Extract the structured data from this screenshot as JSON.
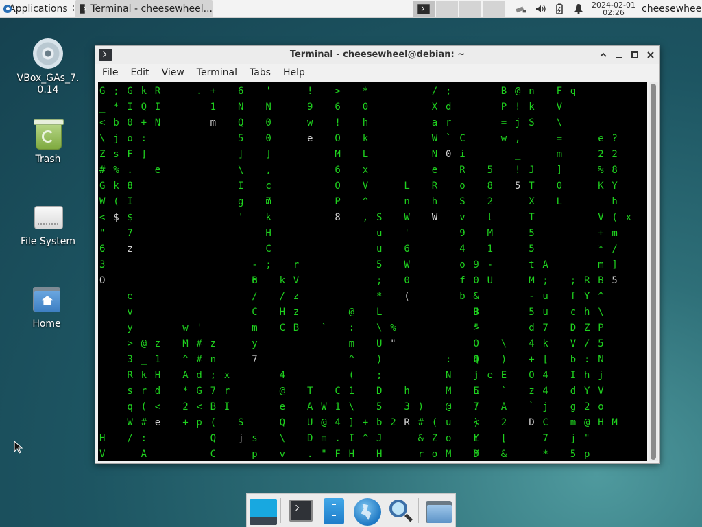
{
  "top_panel": {
    "applications_label": "Applications",
    "task_title": "Terminal - cheesewheel...",
    "clock_date": "2024-02-01",
    "clock_time": "02:26",
    "user": "cheesewheel"
  },
  "desktop": {
    "icons": [
      {
        "label": "VBox_GAs_7.\n0.14",
        "icon": "cd-disc-icon"
      },
      {
        "label": "Trash",
        "icon": "trash-icon"
      },
      {
        "label": "File System",
        "icon": "hard-drive-icon"
      },
      {
        "label": "Home",
        "icon": "home-folder-icon"
      }
    ]
  },
  "terminal": {
    "title": "Terminal - cheesewheel@debian: ~",
    "menu": [
      "File",
      "Edit",
      "View",
      "Terminal",
      "Tabs",
      "Help"
    ],
    "matrix_colors": {
      "green": "#1fd11f",
      "white": "#d0d0d0",
      "background": "#000000"
    },
    "matrix_columns": [
      {
        "col": 0,
        "row": 0,
        "chars": "G_<\\Z#GW<\"63O"
      },
      {
        "col": 0,
        "row": 22,
        "chars": "HV"
      },
      {
        "col": 1,
        "row": 0,
        "chars": ";*bjs%k($"
      },
      {
        "col": 2,
        "row": 0,
        "chars": "GI0oF.8I$7z"
      },
      {
        "col": 2,
        "row": 13,
        "chars": "evy>3RsqW/"
      },
      {
        "col": 3,
        "row": 0,
        "chars": "kQ+:]"
      },
      {
        "col": 3,
        "row": 16,
        "chars": "@_kr(#:A"
      },
      {
        "col": 4,
        "row": 0,
        "chars": "RIN"
      },
      {
        "col": 4,
        "row": 5,
        "chars": "e"
      },
      {
        "col": 4,
        "row": 16,
        "chars": "z1Hd<e"
      },
      {
        "col": 6,
        "row": 15,
        "chars": "wM^A*2+"
      },
      {
        "col": 7,
        "row": 0,
        "chars": "."
      },
      {
        "col": 7,
        "row": 16,
        "chars": "##dG<p"
      },
      {
        "col": 7,
        "row": 15,
        "chars": "'"
      },
      {
        "col": 8,
        "row": 0,
        "chars": "+1m"
      },
      {
        "col": 8,
        "row": 16,
        "chars": "zn;7B(QC"
      },
      {
        "col": 9,
        "row": 18,
        "chars": "xrI"
      },
      {
        "col": 10,
        "row": 0,
        "chars": "6NQ5]\\Ig'"
      },
      {
        "col": 10,
        "row": 21,
        "chars": "Sj"
      },
      {
        "col": 11,
        "row": 11,
        "chars": "-B/C"
      },
      {
        "col": 11,
        "row": 22,
        "chars": "sp"
      },
      {
        "col": 12,
        "row": 0,
        "chars": "'N00],c7kHC;"
      },
      {
        "col": 12,
        "row": 7,
        "chars": "m"
      },
      {
        "col": 11,
        "row": 12,
        "chars": "o"
      },
      {
        "col": 11,
        "row": 15,
        "chars": "m"
      },
      {
        "col": 11,
        "row": 16,
        "chars": "y7"
      },
      {
        "col": 13,
        "row": 12,
        "chars": "k/HC"
      },
      {
        "col": 14,
        "row": 11,
        "chars": "rVzzB"
      },
      {
        "col": 13,
        "row": 18,
        "chars": "4@eQ\\vY/V"
      },
      {
        "col": 15,
        "row": 0,
        "chars": "!9we"
      },
      {
        "col": 15,
        "row": 19,
        "chars": "TAUD.a/Z"
      },
      {
        "col": 16,
        "row": 20,
        "chars": "W@m\"f5+n"
      },
      {
        "col": 16,
        "row": 15,
        "chars": "`"
      },
      {
        "col": 17,
        "row": 0,
        "chars": ">6!OM6OP8"
      },
      {
        "col": 17,
        "row": 19,
        "chars": "C14.F7Fn"
      },
      {
        "col": 18,
        "row": 14,
        "chars": "@:m^(1\\]IHoJ"
      },
      {
        "col": 19,
        "row": 0,
        "chars": "*0hkLxV^,"
      },
      {
        "col": 19,
        "row": 21,
        "chars": "+^"
      },
      {
        "col": 20,
        "row": 8,
        "chars": "Suu5;*L\\U);D5bJH%r"
      },
      {
        "col": 21,
        "row": 15,
        "chars": "%\""
      },
      {
        "col": 21,
        "row": 21,
        "chars": "2"
      },
      {
        "col": 22,
        "row": 6,
        "chars": "LnW'6W0("
      },
      {
        "col": 22,
        "row": 19,
        "chars": "h3R"
      },
      {
        "col": 23,
        "row": 20,
        "chars": ")"
      },
      {
        "col": 23,
        "row": 21,
        "chars": "#&r"
      },
      {
        "col": 24,
        "row": 0,
        "chars": "/XaWNeRhW"
      },
      {
        "col": 24,
        "row": 21,
        "chars": "(Zo"
      },
      {
        "col": 25,
        "row": 0,
        "chars": ";dr`0"
      },
      {
        "col": 25,
        "row": 17,
        "chars": ":NM@uoMl"
      },
      {
        "col": 26,
        "row": 3,
        "chars": "CiRoSv94ofb"
      },
      {
        "col": 27,
        "row": 14,
        "chars": "B\"'4!E7)YD1"
      },
      {
        "col": 27,
        "row": 21,
        "chars": ""
      },
      {
        "col": 27,
        "row": 11,
        "chars": "90&J>OQj5!<LY"
      },
      {
        "col": 28,
        "row": 5,
        "chars": "582tM1-U"
      },
      {
        "col": 28,
        "row": 18,
        "chars": "e"
      },
      {
        "col": 29,
        "row": 16,
        "chars": "\\)E`A2[&"
      },
      {
        "col": 29,
        "row": 0,
        "chars": "BP=w"
      },
      {
        "col": 30,
        "row": 0,
        "chars": "@!j,_!5"
      },
      {
        "col": 31,
        "row": 0,
        "chars": "nkS"
      },
      {
        "col": 31,
        "row": 5,
        "chars": "JTXT55tM-5d4+Oz`D"
      },
      {
        "col": 32,
        "row": 11,
        "chars": "A;uu7k[44jC7*hB"
      },
      {
        "col": 33,
        "row": 0,
        "chars": "FV\\=m]0L"
      },
      {
        "col": 34,
        "row": 0,
        "chars": "q"
      },
      {
        "col": 34,
        "row": 12,
        "chars": ";fcDVbIdgmj5&"
      },
      {
        "col": 35,
        "row": 12,
        "chars": "RYhZ/:hY2@\"p]"
      },
      {
        "col": 36,
        "row": 3,
        "chars": "e2%K_V+*mB^\\P5NjVoH"
      },
      {
        "col": 37,
        "row": 3,
        "chars": "?28Yh(m/]5"
      },
      {
        "col": 37,
        "row": 21,
        "chars": "M"
      },
      {
        "col": 38,
        "row": 8,
        "chars": "x"
      }
    ]
  },
  "dock": {
    "items": [
      "show-desktop-icon",
      "terminal-icon",
      "file-manager-icon",
      "web-browser-icon",
      "app-finder-icon",
      "folder-icon"
    ]
  }
}
